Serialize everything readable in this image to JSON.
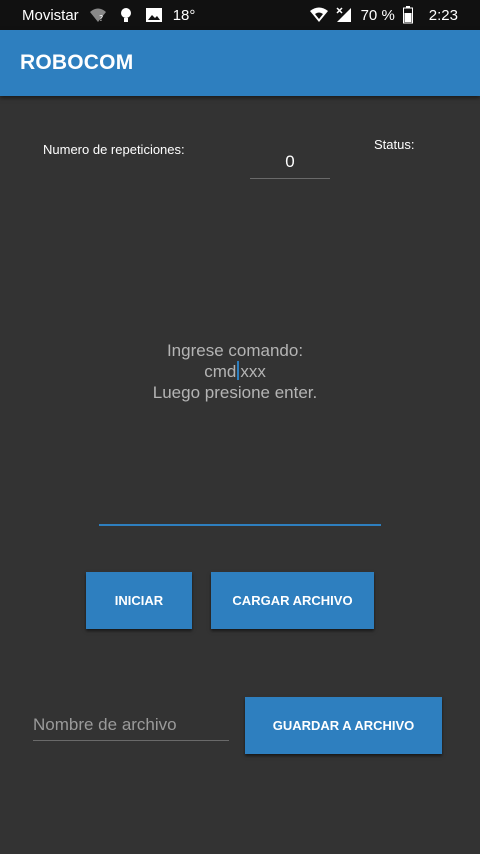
{
  "status_bar": {
    "carrier": "Movistar",
    "temperature": "18°",
    "battery": "70 %",
    "time": "2:23",
    "icons": [
      "wifi-question-icon",
      "bulb-icon",
      "image-icon",
      "wifi-icon",
      "signal-icon",
      "battery-icon"
    ]
  },
  "appbar": {
    "title": "ROBOCOM",
    "color": "#2e7fbf"
  },
  "repeticiones": {
    "label": "Numero de repeticiones:",
    "value": "0"
  },
  "status": {
    "label": "Status:"
  },
  "instructions": {
    "line1": "Ingrese comando:",
    "line2_before_caret": "cmd",
    "line2_after_caret": "xxx",
    "line3": "Luego presione enter."
  },
  "buttons": {
    "iniciar": "INICIAR",
    "cargar_archivo": "CARGAR ARCHIVO",
    "guardar_archivo": "GUARDAR A ARCHIVO"
  },
  "file_name": {
    "placeholder": "Nombre de archivo",
    "value": ""
  }
}
